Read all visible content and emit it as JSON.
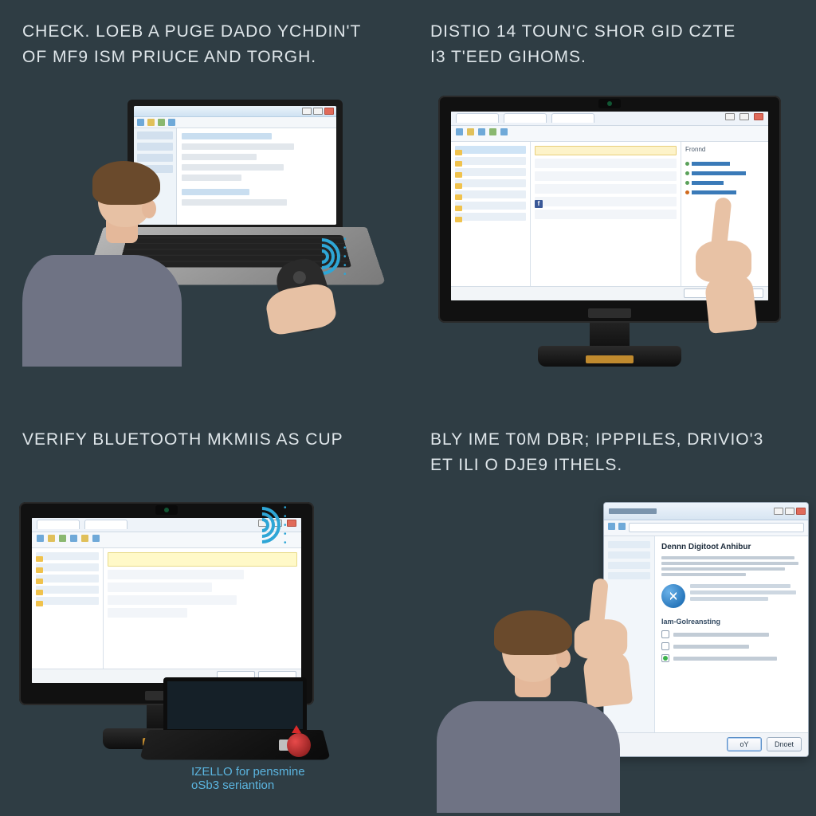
{
  "quads": {
    "q1": {
      "caption_l1": "CHECK. LOEB A PUGE DADO YCHDIN'T",
      "caption_l2": "OF MF9 ISM PRIUCE AND TORGH."
    },
    "q2": {
      "caption_l1": "DISTIO 14 TOUN'C SHOR GID CZTE",
      "caption_l2": "I3 T'EED GIHOMS.",
      "panel_label": "Fronnd"
    },
    "q3": {
      "caption": "VERIFY BLUETOOTH MkMIiS AS CUP",
      "sub_l1": "IZELLO for pensmine",
      "sub_l2": "oSb3 seriantion"
    },
    "q4": {
      "caption_l1": "BLY IME T0M DBR; IPPPILES, DRIVIO'3",
      "caption_l2": "ET ILI O DJE9 ITHELS.",
      "dialog_heading": "Dennn Digitoot Anhibur",
      "section_heading": "Iam-Golreansting",
      "btn_ok": "oY",
      "btn_cancel": "Dnoet"
    }
  }
}
